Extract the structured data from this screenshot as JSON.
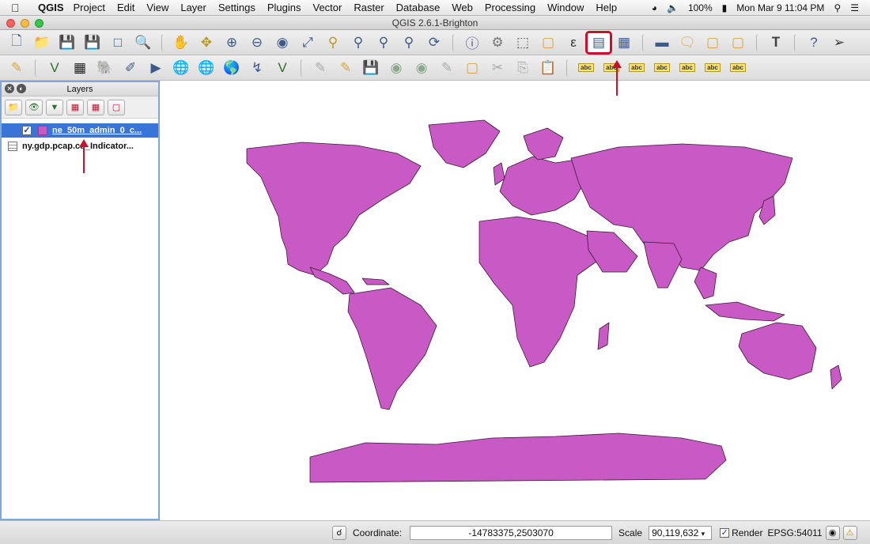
{
  "menubar": {
    "app": "QGIS",
    "items": [
      "Project",
      "Edit",
      "View",
      "Layer",
      "Settings",
      "Plugins",
      "Vector",
      "Raster",
      "Database",
      "Web",
      "Processing",
      "Window",
      "Help"
    ],
    "battery": "100%",
    "clock": "Mon Mar 9  11:04 PM"
  },
  "window": {
    "title": "QGIS 2.6.1-Brighton"
  },
  "toolbar2": {
    "label_tool": "abc"
  },
  "layers_panel": {
    "title": "Layers",
    "layers": [
      {
        "name": "ne_50m_admin_0_c...",
        "checked": true,
        "selected": true,
        "fill_color": "#c959c4"
      },
      {
        "name": "ny.gdp.pcap.cd_Indicator...",
        "checked": false,
        "selected": false
      }
    ]
  },
  "map": {
    "land_color": "#c959c4",
    "border_color": "#3a1a39",
    "background": "#ffffff"
  },
  "statusbar": {
    "coordinate_label": "Coordinate:",
    "coordinate_value": "-14783375,2503070",
    "scale_label": "Scale",
    "scale_value": "90,119,632",
    "render_label": "Render",
    "crs": "EPSG:54011"
  },
  "annotation_color": "#c8102e"
}
